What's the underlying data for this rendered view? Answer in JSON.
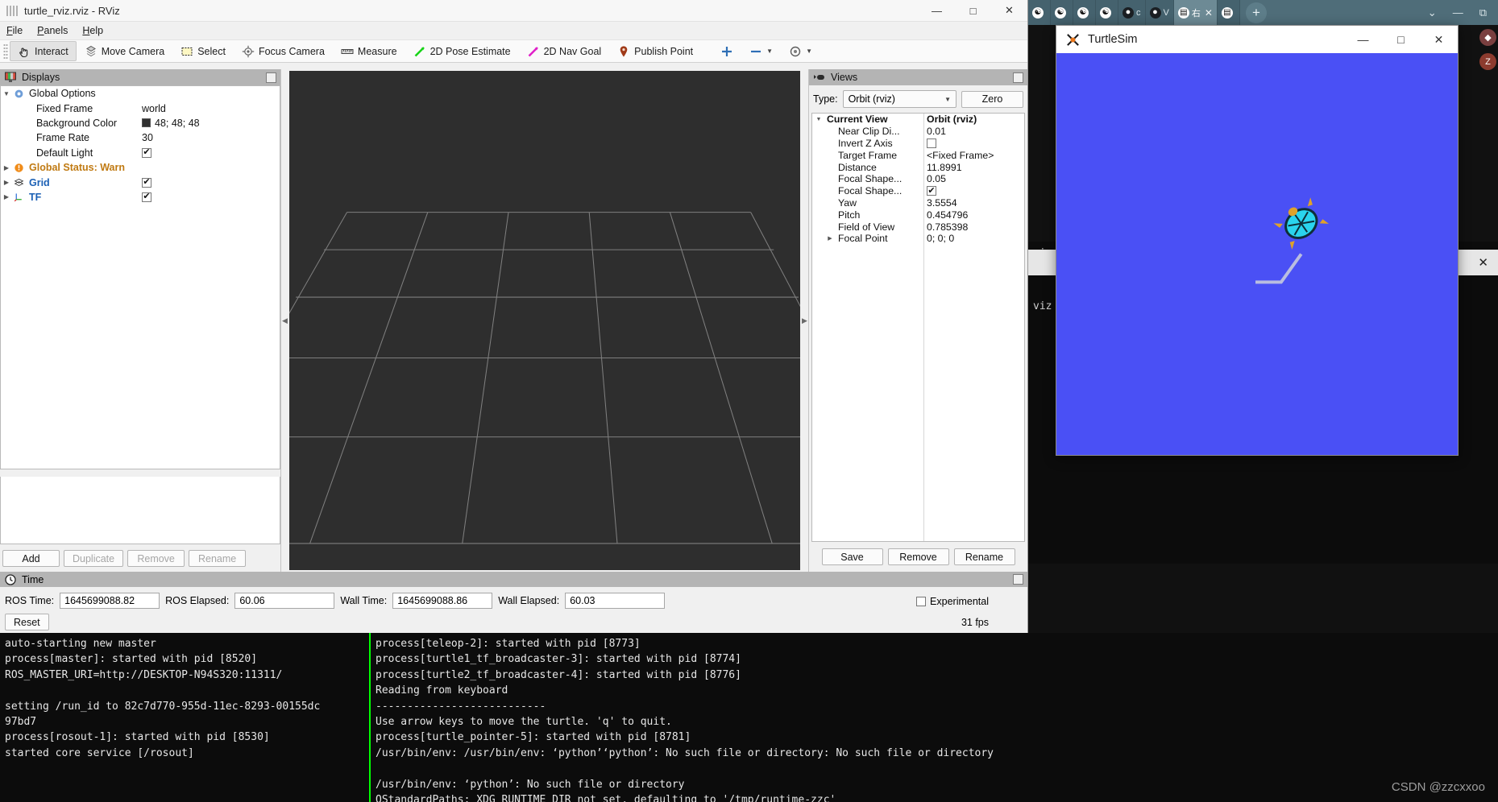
{
  "browser": {
    "tabs": [
      {
        "label": "",
        "icon": "taichi-icon",
        "active": false
      },
      {
        "label": "",
        "icon": "taichi-icon",
        "active": false
      },
      {
        "label": "",
        "icon": "taichi-icon",
        "active": false
      },
      {
        "label": "",
        "icon": "taichi-icon",
        "active": false
      },
      {
        "label": "c",
        "icon": "github-icon",
        "active": false
      },
      {
        "label": "V",
        "icon": "github-icon",
        "active": false
      },
      {
        "label": "右",
        "icon": "page-icon",
        "active": true
      },
      {
        "label": "",
        "icon": "doc-icon",
        "active": false
      }
    ],
    "new_tab_label": "+",
    "window_controls": [
      "⌄",
      "—",
      "❐"
    ]
  },
  "rviz": {
    "title": "turtle_rviz.rviz - RViz",
    "window_controls": {
      "minimize": "—",
      "maximize": "□",
      "close": "✕"
    },
    "menu": [
      {
        "label": "File",
        "mnemonic": "F"
      },
      {
        "label": "Panels",
        "mnemonic": "P"
      },
      {
        "label": "Help",
        "mnemonic": "H"
      }
    ],
    "toolbar": [
      {
        "label": "Interact",
        "icon": "hand-cursor-icon",
        "selected": true
      },
      {
        "label": "Move Camera",
        "icon": "move-camera-icon",
        "selected": false
      },
      {
        "label": "Select",
        "icon": "select-rect-icon",
        "selected": false
      },
      {
        "label": "Focus Camera",
        "icon": "focus-camera-icon",
        "selected": false
      },
      {
        "label": "Measure",
        "icon": "ruler-icon",
        "selected": false
      },
      {
        "label": "2D Pose Estimate",
        "icon": "pose-estimate-icon",
        "selected": false
      },
      {
        "label": "2D Nav Goal",
        "icon": "nav-goal-icon",
        "selected": false
      },
      {
        "label": "Publish Point",
        "icon": "map-pin-icon",
        "selected": false
      }
    ],
    "toolbar_extra": [
      {
        "icon": "add-tool-icon"
      },
      {
        "icon": "remove-tool-icon"
      },
      {
        "icon": "tool-properties-icon"
      }
    ]
  },
  "displays": {
    "panel_title": "Displays",
    "panel_icon": "displays-icon",
    "rows": [
      {
        "label": "Global Options",
        "value": "",
        "type": "group",
        "icon": "gear-icon",
        "expanded": true,
        "indent": 0,
        "color": "#111111"
      },
      {
        "label": "Fixed Frame",
        "value": "world",
        "type": "text",
        "indent": 1,
        "color": "#111111"
      },
      {
        "label": "Background Color",
        "value": "48; 48; 48",
        "type": "color",
        "swatch": "#303030",
        "indent": 1,
        "color": "#111111"
      },
      {
        "label": "Frame Rate",
        "value": "30",
        "type": "text",
        "indent": 1,
        "color": "#111111"
      },
      {
        "label": "Default Light",
        "value": "",
        "type": "checkbox",
        "checked": true,
        "indent": 1,
        "color": "#111111"
      },
      {
        "label": "Global Status: Warn",
        "value": "",
        "type": "status",
        "icon": "warning-icon",
        "indent": 0,
        "color": "#c07a12",
        "collapsed": true
      },
      {
        "label": "Grid",
        "value": "",
        "type": "display",
        "icon": "grid-icon",
        "checked": true,
        "indent": 0,
        "color": "#1a5fb4",
        "collapsed": true
      },
      {
        "label": "TF",
        "value": "",
        "type": "display",
        "icon": "tf-axes-icon",
        "checked": true,
        "indent": 0,
        "color": "#1a5fb4",
        "collapsed": true
      }
    ],
    "buttons": [
      {
        "label": "Add",
        "enabled": true
      },
      {
        "label": "Duplicate",
        "enabled": false
      },
      {
        "label": "Remove",
        "enabled": false
      },
      {
        "label": "Rename",
        "enabled": false
      }
    ]
  },
  "views": {
    "panel_title": "Views",
    "panel_icon": "views-camera-icon",
    "type_label": "Type:",
    "type_value": "Orbit (rviz)",
    "zero_button": "Zero",
    "rows": [
      {
        "label": "Current View",
        "value": "Orbit (rviz)",
        "header": true,
        "expanded": true,
        "indent": 0
      },
      {
        "label": "Near Clip Di...",
        "value": "0.01",
        "indent": 1
      },
      {
        "label": "Invert Z Axis",
        "value": "",
        "type": "checkbox",
        "checked": false,
        "indent": 1
      },
      {
        "label": "Target Frame",
        "value": "<Fixed Frame>",
        "indent": 1
      },
      {
        "label": "Distance",
        "value": "11.8991",
        "indent": 1
      },
      {
        "label": "Focal Shape...",
        "value": "0.05",
        "indent": 1
      },
      {
        "label": "Focal Shape...",
        "value": "",
        "type": "checkbox",
        "checked": true,
        "indent": 1
      },
      {
        "label": "Yaw",
        "value": "3.5554",
        "indent": 1
      },
      {
        "label": "Pitch",
        "value": "0.454796",
        "indent": 1
      },
      {
        "label": "Field of View",
        "value": "0.785398",
        "indent": 1
      },
      {
        "label": "Focal Point",
        "value": "0; 0; 0",
        "indent": 1,
        "collapsed": true
      }
    ],
    "buttons": [
      {
        "label": "Save"
      },
      {
        "label": "Remove"
      },
      {
        "label": "Rename"
      }
    ]
  },
  "time": {
    "panel_title": "Time",
    "panel_icon": "clock-icon",
    "fields": [
      {
        "label": "ROS Time:",
        "value": "1645699088.82"
      },
      {
        "label": "ROS Elapsed:",
        "value": "60.06"
      },
      {
        "label": "Wall Time:",
        "value": "1645699088.86"
      },
      {
        "label": "Wall Elapsed:",
        "value": "60.03"
      }
    ],
    "experimental_label": "Experimental",
    "experimental_checked": false,
    "reset_button": "Reset",
    "fps": "31 fps"
  },
  "turtlesim": {
    "title": "TurtleSim",
    "icon": "x11-icon",
    "window_controls": {
      "minimize": "—",
      "maximize": "□",
      "close": "✕"
    },
    "canvas_color": "#4a50f5",
    "turtle_color": "#2ad4ee",
    "path_color": "#b9bde0"
  },
  "terminal_left": {
    "lines": [
      "auto-starting new master",
      "process[master]: started with pid [8520]",
      "ROS_MASTER_URI=http://DESKTOP-N94S320:11311/",
      "",
      "setting /run_id to 82c7d770-955d-11ec-8293-00155dc",
      "97bd7",
      "process[rosout-1]: started with pid [8530]",
      "started core service [/rosout]"
    ]
  },
  "terminal_right": {
    "lines": [
      "process[teleop-2]: started with pid [8773]",
      "process[turtle1_tf_broadcaster-3]: started with pid [8774]",
      "process[turtle2_tf_broadcaster-4]: started with pid [8776]",
      "Reading from keyboard",
      "---------------------------",
      "Use arrow keys to move the turtle. 'q' to quit.",
      "process[turtle_pointer-5]: started with pid [8781]",
      "/usr/bin/env: /usr/bin/env: ‘python’‘python’: No such file or directory: No such file or directory",
      "",
      "/usr/bin/env: ‘python’: No such file or directory",
      "QStandardPaths: XDG_RUNTIME_DIR not set, defaulting to '/tmp/runtime-zzc'"
    ]
  },
  "background_terminal": {
    "lines": [
      "viz",
      "",
      "",
      "viz"
    ],
    "close_label": "✕"
  },
  "watermark": "CSDN @zzcxxoo"
}
